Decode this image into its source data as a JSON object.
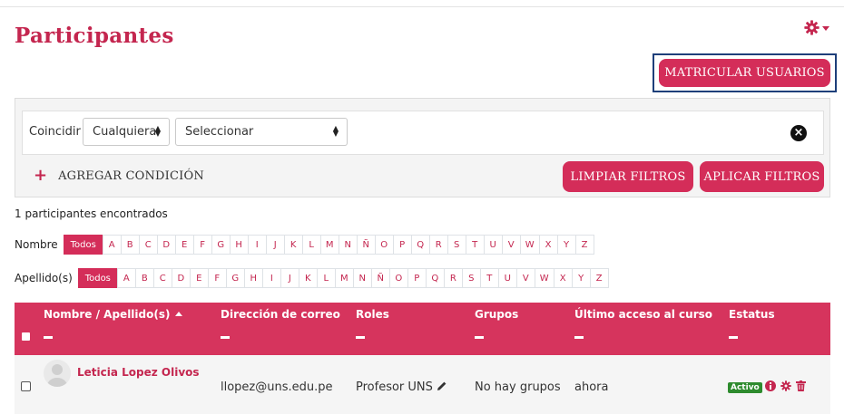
{
  "page": {
    "title": "Participantes"
  },
  "actions": {
    "enrol_label": "MATRICULAR USUARIOS"
  },
  "filters": {
    "match_label": "Coincidir",
    "match_value": "Cualquiera",
    "filter_type_value": "Seleccionar",
    "add_condition_label": "AGREGAR CONDICIÓN",
    "clear_label": "LIMPIAR FILTROS",
    "apply_label": "APLICAR FILTROS"
  },
  "results": {
    "count_text": "1 participantes encontrados"
  },
  "initials": {
    "first_name_label": "Nombre",
    "surname_label": "Apellido(s)",
    "all_label": "Todos",
    "letters": [
      "A",
      "B",
      "C",
      "D",
      "E",
      "F",
      "G",
      "H",
      "I",
      "J",
      "K",
      "L",
      "M",
      "N",
      "Ñ",
      "O",
      "P",
      "Q",
      "R",
      "S",
      "T",
      "U",
      "V",
      "W",
      "X",
      "Y",
      "Z"
    ]
  },
  "table": {
    "columns": [
      "Nombre / Apellido(s)",
      "Dirección de correo",
      "Roles",
      "Grupos",
      "Último acceso al curso",
      "Estatus"
    ],
    "rows": [
      {
        "name": "Leticia Lopez Olivos",
        "email": "llopez@uns.edu.pe",
        "role": "Profesor UNS",
        "groups": "No hay grupos",
        "last_access": "ahora",
        "status": "Activo"
      }
    ]
  },
  "icons": {
    "settings": "gear-icon",
    "add": "plus-icon",
    "remove_condition": "close-circle-icon",
    "edit_role": "pencil-icon",
    "info": "info-icon",
    "delete": "trash-icon"
  },
  "colors": {
    "brand": "#d42d59",
    "title": "#c4264f",
    "status_active": "#2e8b2e",
    "enrol_focus_border": "#1e3f7a"
  }
}
